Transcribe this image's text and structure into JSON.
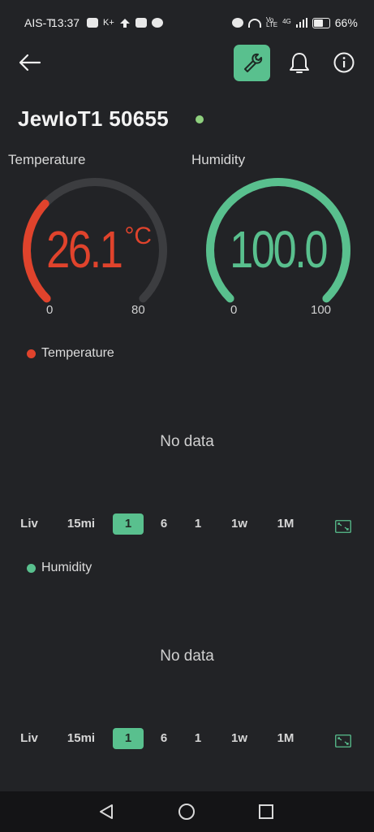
{
  "status_bar": {
    "carrier": "AIS-T",
    "time": "13:37",
    "network": "4G",
    "battery": "66%"
  },
  "device": {
    "name": "JewIoT1 50655",
    "status_color": "#8fd07e"
  },
  "gauges": [
    {
      "title": "Temperature",
      "value": "26.1",
      "unit": "°C",
      "value_num": 26.1,
      "min": "0",
      "max": "80",
      "min_num": 0,
      "max_num": 80,
      "color": "#e0432c"
    },
    {
      "title": "Humidity",
      "value": "100.0",
      "unit": "",
      "value_num": 100.0,
      "min": "0",
      "max": "100",
      "min_num": 0,
      "max_num": 100,
      "color": "#59c08e"
    }
  ],
  "charts": [
    {
      "legend": "Temperature",
      "color": "#e0432c",
      "empty_text": "No data"
    },
    {
      "legend": "Humidity",
      "color": "#59c08e",
      "empty_text": "No data"
    }
  ],
  "timeframes": [
    "Liv",
    "15mi",
    "1",
    "6",
    "1",
    "1w",
    "1M"
  ],
  "active_timeframe_index": 2,
  "accent_color": "#59c08e",
  "icons": {
    "back": "arrow-left-icon",
    "settings": "wrench-icon",
    "notifications": "bell-icon",
    "info": "info-icon",
    "expand": "expand-icon",
    "nav_back": "triangle-back-icon",
    "nav_home": "circle-home-icon",
    "nav_recents": "square-recents-icon"
  }
}
